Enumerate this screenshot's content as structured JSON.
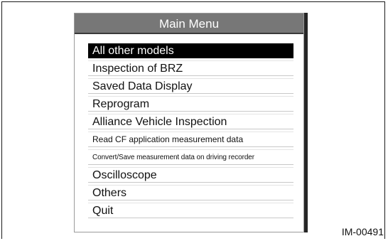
{
  "window": {
    "title": "Main Menu"
  },
  "menu": {
    "items": [
      {
        "label": "All other models",
        "selected": true
      },
      {
        "label": "Inspection of BRZ",
        "selected": false
      },
      {
        "label": "Saved Data Display",
        "selected": false
      },
      {
        "label": "Reprogram",
        "selected": false
      },
      {
        "label": "Alliance Vehicle Inspection",
        "selected": false
      },
      {
        "label": "Read CF application measurement data",
        "selected": false
      },
      {
        "label": "Convert/Save measurement data on driving recorder",
        "selected": false
      },
      {
        "label": "Oscilloscope",
        "selected": false
      },
      {
        "label": "Others",
        "selected": false
      },
      {
        "label": "Quit",
        "selected": false
      }
    ]
  },
  "caption": "IM-00491",
  "colors": {
    "title_bar": "#777777",
    "selected_bg": "#000000",
    "selected_text": "#ffffff"
  }
}
